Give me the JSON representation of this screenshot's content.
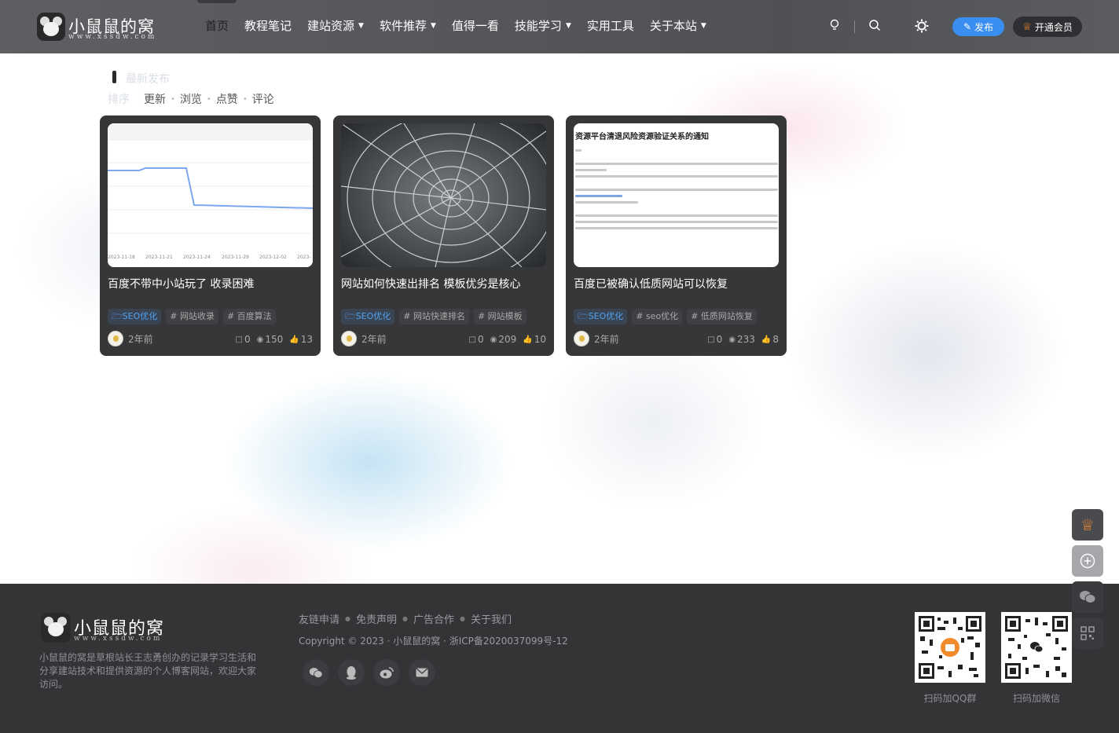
{
  "header": {
    "logo_title": "小鼠鼠的窝",
    "logo_sub": "www.xssdw.com",
    "nav": [
      {
        "label": "首页",
        "active": true,
        "dropdown": false
      },
      {
        "label": "教程笔记",
        "dropdown": false
      },
      {
        "label": "建站资源",
        "dropdown": true
      },
      {
        "label": "软件推荐",
        "dropdown": true
      },
      {
        "label": "值得一看",
        "dropdown": false
      },
      {
        "label": "技能学习",
        "dropdown": true
      },
      {
        "label": "实用工具",
        "dropdown": false
      },
      {
        "label": "关于本站",
        "dropdown": true
      }
    ],
    "publish_label": "发布",
    "vip_label": "开通会员"
  },
  "main": {
    "section_title": "最新发布",
    "sort_label": "排序",
    "sort_options": [
      "更新",
      "浏览",
      "点赞",
      "评论"
    ]
  },
  "posts": [
    {
      "title": "百度不带中小站玩了 收录困难",
      "category": "SEO优化",
      "tags": [
        "# 网站收录",
        "# 百度算法"
      ],
      "time": "2年前",
      "comments": "0",
      "views": "150",
      "likes": "13",
      "chart_dates": [
        "2023-11-18",
        "2023-11-21",
        "2023-11-24",
        "2023-11-29",
        "2023-12-02",
        "2023-"
      ]
    },
    {
      "title": "网站如何快速出排名 模板优劣是核心",
      "category": "SEO优化",
      "tags": [
        "# 网站快速排名",
        "# 网站模板"
      ],
      "time": "2年前",
      "comments": "0",
      "views": "209",
      "likes": "10"
    },
    {
      "title": "百度已被确认低质网站可以恢复",
      "category": "SEO优化",
      "tags": [
        "# seo优化",
        "# 低质网站恢复"
      ],
      "time": "2年前",
      "comments": "0",
      "views": "233",
      "likes": "8",
      "doc_heading": "资源平台清退风险资源验证关系的通知"
    }
  ],
  "footer": {
    "logo_title": "小鼠鼠的窝",
    "logo_sub": "www.xssdw.com",
    "description": "小鼠鼠的窝是草根站长王志勇创办的记录学习生活和分享建站技术和提供资源的个人博客网站，欢迎大家访问。",
    "links": [
      "友链申请",
      "免责声明",
      "广告合作",
      "关于我们"
    ],
    "copyright": "Copyright © 2023 · 小鼠鼠的窝 · 浙ICP备2020037099号-12",
    "qr_qq_label": "扫码加QQ群",
    "qr_wechat_label": "扫码加微信"
  },
  "colors": {
    "accent": "#3a8ef0",
    "crown": "#f08a2c",
    "card_bg": "#363739",
    "footer_bg": "#333436"
  }
}
